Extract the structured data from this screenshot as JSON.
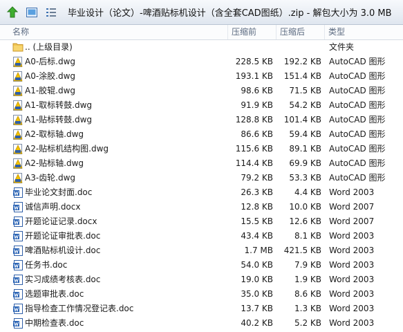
{
  "window": {
    "title": "毕业设计（论文）-啤酒贴标机设计（含全套CAD图纸）.zip - 解包大小为 3.0 MB"
  },
  "toolbar": {
    "up_icon": "up-arrow-icon",
    "view_icon": "view-icon",
    "details_icon": "details-view-icon",
    "accent": "#3a9a2c"
  },
  "columns": {
    "name": "名称",
    "size": "压缩前",
    "compressed": "压缩后",
    "type": "类型"
  },
  "rows": [
    {
      "name": ".. (上级目录)",
      "size": "",
      "compressed": "",
      "type": "文件夹",
      "icon": "folder"
    },
    {
      "name": "A0-后标.dwg",
      "size": "228.5 KB",
      "compressed": "192.2 KB",
      "type": "AutoCAD 图形",
      "icon": "dwg"
    },
    {
      "name": "A0-涂胶.dwg",
      "size": "193.1 KB",
      "compressed": "151.4 KB",
      "type": "AutoCAD 图形",
      "icon": "dwg"
    },
    {
      "name": "A1-胶辊.dwg",
      "size": "98.6 KB",
      "compressed": "71.5 KB",
      "type": "AutoCAD 图形",
      "icon": "dwg"
    },
    {
      "name": "A1-取标转鼓.dwg",
      "size": "91.9 KB",
      "compressed": "54.2 KB",
      "type": "AutoCAD 图形",
      "icon": "dwg"
    },
    {
      "name": "A1-贴标转鼓.dwg",
      "size": "128.8 KB",
      "compressed": "101.4 KB",
      "type": "AutoCAD 图形",
      "icon": "dwg"
    },
    {
      "name": "A2-取标轴.dwg",
      "size": "86.6 KB",
      "compressed": "59.4 KB",
      "type": "AutoCAD 图形",
      "icon": "dwg"
    },
    {
      "name": "A2-贴标机结构图.dwg",
      "size": "115.6 KB",
      "compressed": "89.1 KB",
      "type": "AutoCAD 图形",
      "icon": "dwg"
    },
    {
      "name": "A2-贴标轴.dwg",
      "size": "114.4 KB",
      "compressed": "69.9 KB",
      "type": "AutoCAD 图形",
      "icon": "dwg"
    },
    {
      "name": "A3-齿轮.dwg",
      "size": "79.2 KB",
      "compressed": "53.3 KB",
      "type": "AutoCAD 图形",
      "icon": "dwg"
    },
    {
      "name": "毕业论文封面.doc",
      "size": "26.3 KB",
      "compressed": "4.4 KB",
      "type": "Word 2003",
      "icon": "doc"
    },
    {
      "name": "诚信声明.docx",
      "size": "12.8 KB",
      "compressed": "10.0 KB",
      "type": "Word 2007",
      "icon": "doc"
    },
    {
      "name": "开题论证记录.docx",
      "size": "15.5 KB",
      "compressed": "12.6 KB",
      "type": "Word 2007",
      "icon": "doc"
    },
    {
      "name": "开题论证审批表.doc",
      "size": "43.4 KB",
      "compressed": "8.1 KB",
      "type": "Word 2003",
      "icon": "doc"
    },
    {
      "name": "啤酒贴标机设计.doc",
      "size": "1.7 MB",
      "compressed": "421.5 KB",
      "type": "Word 2003",
      "icon": "doc"
    },
    {
      "name": "任务书.doc",
      "size": "54.0 KB",
      "compressed": "7.9 KB",
      "type": "Word 2003",
      "icon": "doc"
    },
    {
      "name": "实习成绩考核表.doc",
      "size": "19.0 KB",
      "compressed": "1.9 KB",
      "type": "Word 2003",
      "icon": "doc"
    },
    {
      "name": "选题审批表.doc",
      "size": "35.0 KB",
      "compressed": "8.6 KB",
      "type": "Word 2003",
      "icon": "doc"
    },
    {
      "name": "指导检查工作情况登记表.doc",
      "size": "13.7 KB",
      "compressed": "1.3 KB",
      "type": "Word 2003",
      "icon": "doc"
    },
    {
      "name": "中期检查表.doc",
      "size": "40.2 KB",
      "compressed": "5.2 KB",
      "type": "Word 2003",
      "icon": "doc"
    }
  ]
}
